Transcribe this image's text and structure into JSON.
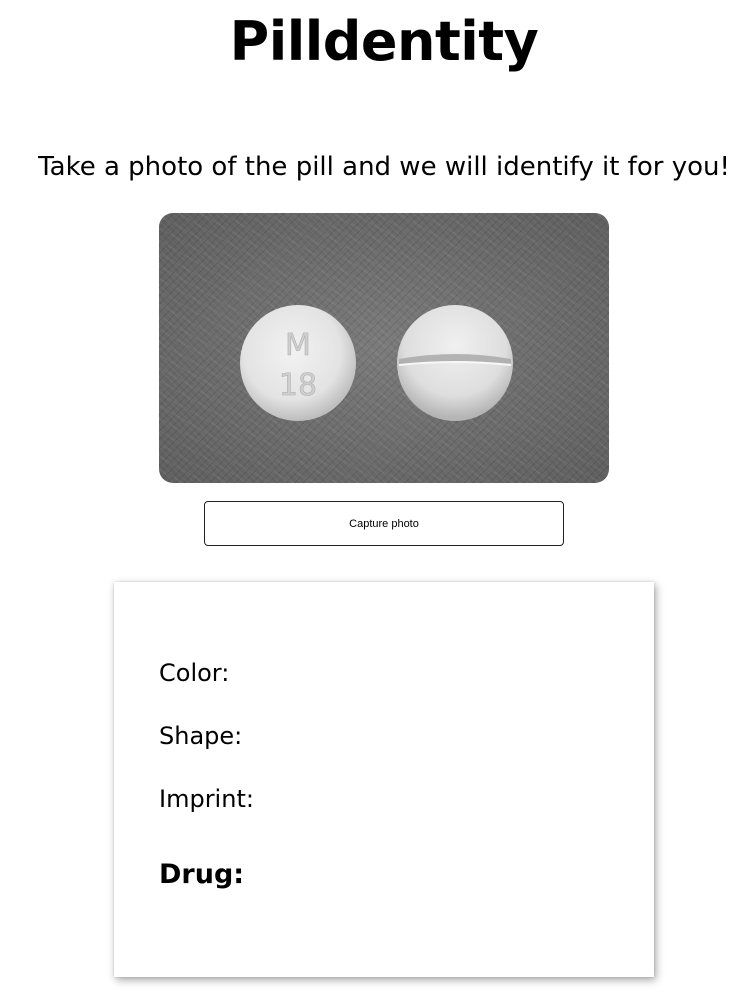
{
  "app": {
    "title": "Pilldentity",
    "subtitle": "Take a photo of the pill and we will identify it for you!"
  },
  "camera": {
    "capture_label": "Capture photo",
    "pill_imprint_line1": "M",
    "pill_imprint_line2": "18"
  },
  "results": {
    "color_label": "Color:",
    "color_value": "",
    "shape_label": "Shape:",
    "shape_value": "",
    "imprint_label": "Imprint:",
    "imprint_value": "",
    "drug_label": "Drug:",
    "drug_value": ""
  }
}
